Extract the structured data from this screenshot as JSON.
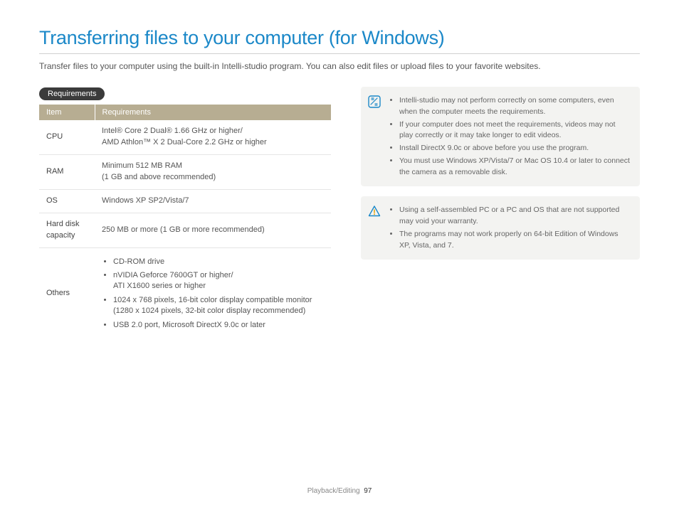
{
  "title": "Transferring files to your computer (for Windows)",
  "intro": "Transfer files to your computer using the built-in Intelli-studio program. You can also edit files or upload files to your favorite websites.",
  "requirements": {
    "badge": "Requirements",
    "headers": {
      "item": "Item",
      "req": "Requirements"
    },
    "rows": {
      "cpu_label": "CPU",
      "cpu_val": "Intel® Core 2 Dual® 1.66 GHz or higher/\nAMD Athlon™ X 2 Dual-Core 2.2 GHz or higher",
      "ram_label": "RAM",
      "ram_val": "Minimum 512 MB RAM\n(1 GB and above recommended)",
      "os_label": "OS",
      "os_val": "Windows XP SP2/Vista/7",
      "hd_label": "Hard disk capacity",
      "hd_val": "250 MB or more (1 GB or more recommended)",
      "others_label": "Others",
      "others_items": {
        "a": "CD-ROM drive",
        "b": "nVIDIA Geforce 7600GT or higher/\nATI X1600 series or higher",
        "c": "1024 x 768 pixels, 16-bit color display compatible monitor (1280 x 1024 pixels, 32-bit color display recommended)",
        "d": "USB 2.0 port, Microsoft DirectX 9.0c or later"
      }
    }
  },
  "note1": {
    "a": "Intelli-studio may not perform correctly on some computers, even when the computer meets the requirements.",
    "b": "If your computer does not meet the requirements, videos may not play correctly or it may take longer to edit videos.",
    "c": "Install DirectX 9.0c or above before you use the program.",
    "d": "You must use Windows XP/Vista/7 or Mac OS 10.4 or later to connect the camera as a removable disk."
  },
  "note2": {
    "a": "Using a self-assembled PC or a PC and OS that are not supported may void your warranty.",
    "b": "The programs may not work properly on 64-bit Edition of Windows XP, Vista, and 7."
  },
  "footer": {
    "section": "Playback/Editing",
    "page": "97"
  }
}
